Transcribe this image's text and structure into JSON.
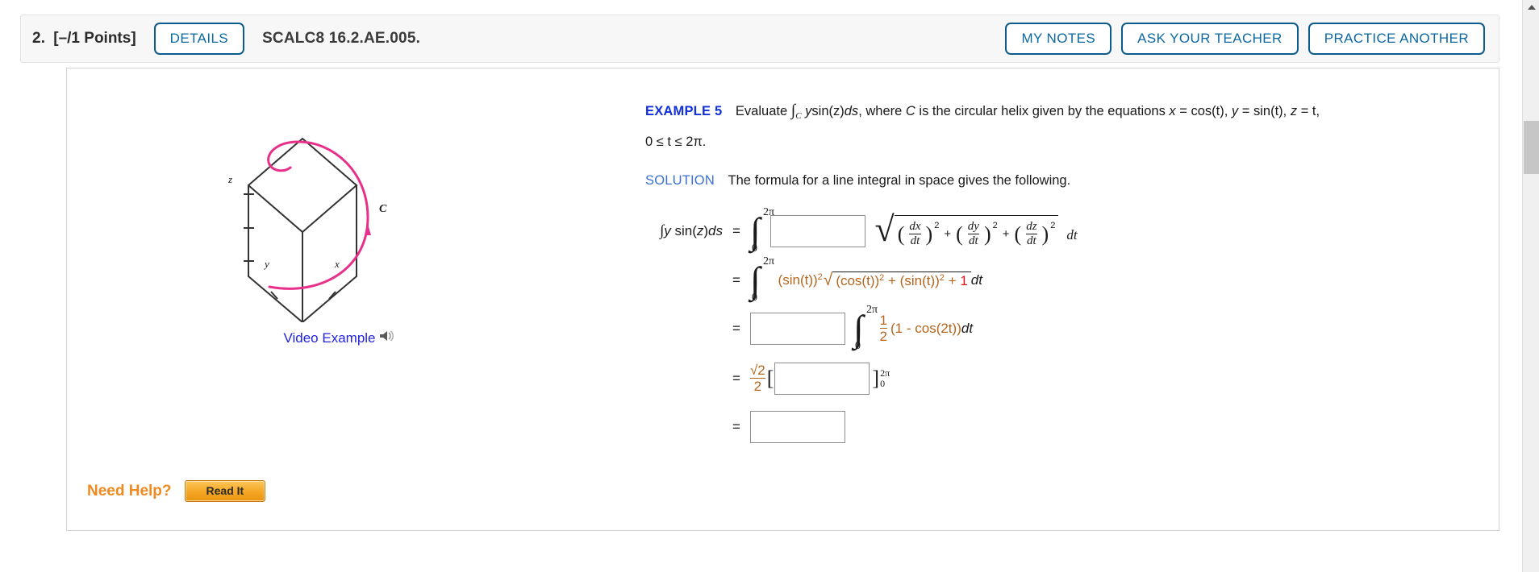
{
  "header": {
    "question_number": "2.",
    "points": "[–/1 Points]",
    "details_button": "DETAILS",
    "assignment_code": "SCALC8 16.2.AE.005.",
    "my_notes_button": "MY NOTES",
    "ask_teacher_button": "ASK YOUR TEACHER",
    "practice_another_button": "PRACTICE ANOTHER"
  },
  "figure": {
    "axis_z": "z",
    "axis_y": "y",
    "axis_x": "x",
    "curve_label": "C",
    "curve_color": "#e8308a",
    "video_example_label": "Video Example",
    "speaker_icon": "speaker-icon"
  },
  "example": {
    "tag": "EXAMPLE 5",
    "text_1": "Evaluate",
    "integral": "∫",
    "integral_sub": "C",
    "integrand": "y",
    "integrand_fn": "sin(z)",
    "differential": "ds",
    "text_2": ", where",
    "curve_var": "C",
    "text_3": "is the circular helix given by the equations",
    "eq_x": "x",
    "eq_x_val": "= cos(t),",
    "eq_y": "y",
    "eq_y_val": "= sin(t),",
    "eq_z": "z",
    "eq_z_val": "= t,",
    "domain": "0 ≤ t ≤ 2π."
  },
  "solution": {
    "tag": "SOLUTION",
    "text": "The formula for a line integral in space gives the following."
  },
  "equations": {
    "lhs": "∫y sin(z)ds",
    "equals": "=",
    "limit_upper": "2π",
    "limit_lower": "0",
    "line1": {
      "answer_box_value": "",
      "radical_terms": [
        {
          "num": "dx",
          "den": "dt",
          "power": "2"
        },
        {
          "num": "dy",
          "den": "dt",
          "power": "2"
        },
        {
          "num": "dz",
          "den": "dt",
          "power": "2"
        }
      ],
      "plus": "+",
      "dt": "dt"
    },
    "line2": {
      "expr_a": "(sin(t))",
      "expr_a_pow": "2",
      "radical": "√",
      "inside_a": "(cos(t))",
      "inside_a_pow": "2",
      "plus1": "+",
      "inside_b": "(sin(t))",
      "inside_b_pow": "2",
      "plus2": "+",
      "filled_value": "1",
      "dt": "dt"
    },
    "line3": {
      "answer_box_value": "",
      "frac_num": "1",
      "frac_den": "2",
      "expr": "(1 - cos(2t))",
      "dt": "dt"
    },
    "line4": {
      "coef_num": "√2",
      "coef_den": "2",
      "bracket_open": "[",
      "answer_box_value": "",
      "bracket_close": "]",
      "eval_upper": "2π",
      "eval_lower": "0"
    },
    "line5": {
      "answer_box_value": ""
    }
  },
  "need_help": {
    "label": "Need Help?",
    "read_it_button": "Read It"
  },
  "scrollbar": {
    "up_arrow_icon": "chevron-up-icon",
    "thumb": "scroll-thumb"
  }
}
